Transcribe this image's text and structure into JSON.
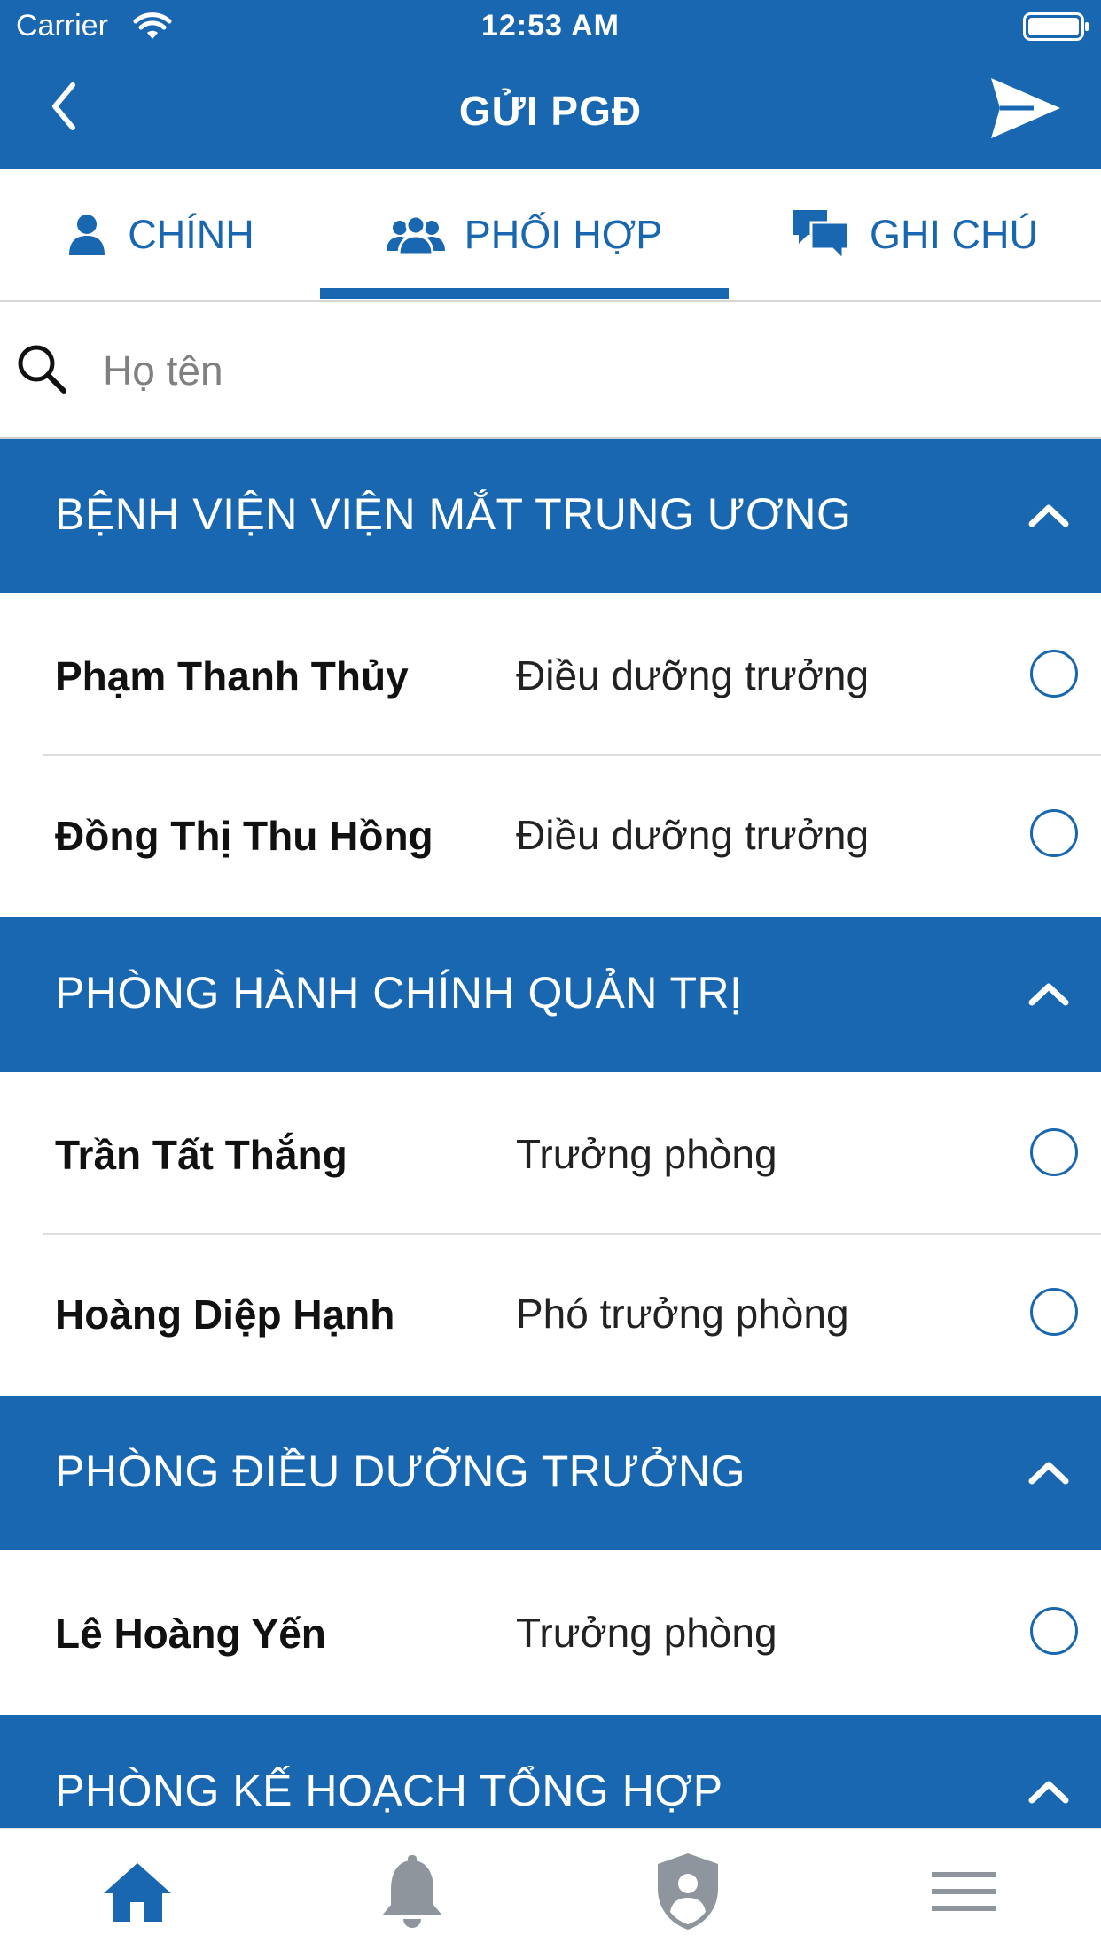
{
  "status_bar": {
    "carrier": "Carrier",
    "time": "12:53 AM"
  },
  "header": {
    "title": "GỬI PGĐ"
  },
  "tabs": [
    {
      "label": "CHÍNH",
      "icon": "person-icon",
      "active": false
    },
    {
      "label": "PHỐI HỢP",
      "icon": "group-icon",
      "active": true
    },
    {
      "label": "GHI CHÚ",
      "icon": "chat-icon",
      "active": false
    }
  ],
  "search": {
    "placeholder": "Họ tên",
    "value": ""
  },
  "groups": [
    {
      "title": "BỆNH VIỆN VIỆN MẮT TRUNG ƯƠNG",
      "members": [
        {
          "name": "Phạm Thanh Thủy",
          "role": "Điều dưỡng trưởng"
        },
        {
          "name": "Đồng Thị Thu Hồng",
          "role": "Điều dưỡng trưởng"
        }
      ]
    },
    {
      "title": "PHÒNG HÀNH CHÍNH QUẢN TRỊ",
      "members": [
        {
          "name": "Trần Tất Thắng",
          "role": "Trưởng phòng"
        },
        {
          "name": "Hoàng Diệp Hạnh",
          "role": "Phó trưởng phòng"
        }
      ]
    },
    {
      "title": "PHÒNG ĐIỀU DƯỠNG TRƯỞNG",
      "members": [
        {
          "name": "Lê Hoàng Yến",
          "role": "Trưởng phòng"
        }
      ]
    },
    {
      "title": "PHÒNG KẾ HOẠCH TỔNG HỢP",
      "members": []
    }
  ],
  "bottom_nav": [
    {
      "icon": "home-icon",
      "active": true
    },
    {
      "icon": "bell-icon",
      "active": false
    },
    {
      "icon": "shield-user-icon",
      "active": false
    },
    {
      "icon": "menu-icon",
      "active": false
    }
  ],
  "colors": {
    "primary": "#1a67b1",
    "inactive_icon": "#8e959c"
  }
}
